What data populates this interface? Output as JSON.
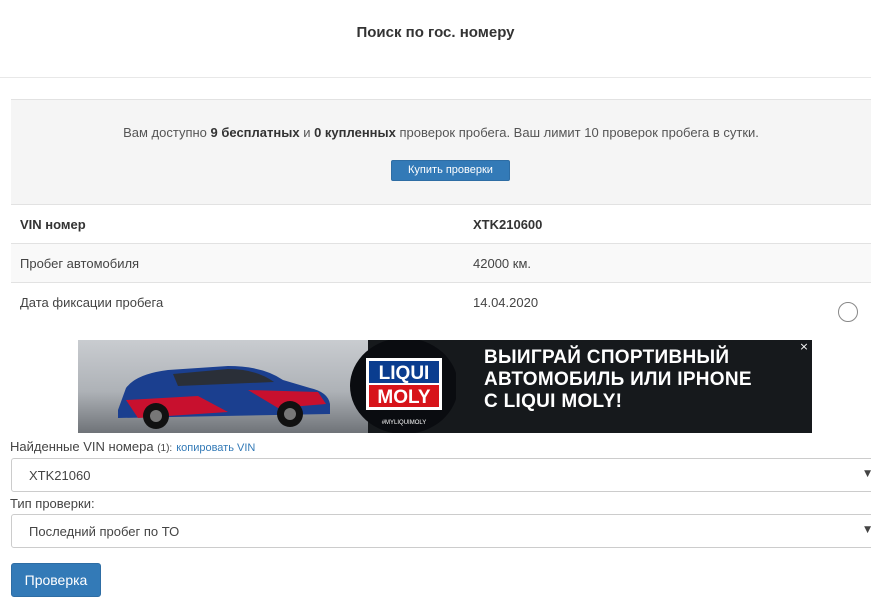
{
  "header": {
    "title": "Поиск по гос. номеру"
  },
  "notice": {
    "text_before": "Вам доступно ",
    "free_count": "9 бесплатных",
    "text_and": " и ",
    "bought_count": "0 купленных",
    "text_after": " проверок пробега. Ваш лимит 10 проверок пробега в сутки.",
    "buy_button": "Купить проверки"
  },
  "info_rows": [
    {
      "label": "VIN номер",
      "value": "XTK210600"
    },
    {
      "label": "Пробег автомобиля",
      "value": "42000 км."
    },
    {
      "label": "Дата фиксации пробега",
      "value": "14.04.2020"
    }
  ],
  "ad": {
    "headline_line1": "ВЫИГРАЙ СПОРТИВНЫЙ",
    "headline_line2": "АВТОМОБИЛЬ ИЛИ IPHONE",
    "headline_line3": "С LIQUI MOLY!",
    "logo_top": "LIQUI",
    "logo_bottom": "MOLY",
    "hashtag": "#MYLIQUIMOLY",
    "close": "×",
    "colors": {
      "logo_red": "#d7141a",
      "logo_blue": "#0a3d8f",
      "car_blue": "#1b3f8f",
      "car_red": "#c8102e"
    }
  },
  "vin_found": {
    "label": "Найденные VIN номера",
    "count": "(1):",
    "copy_link": "копировать VIN",
    "selected": "XTK21060"
  },
  "check_type": {
    "label": "Тип проверки:",
    "selected": "Последний пробег по ТО"
  },
  "submit": {
    "label": "Проверка"
  },
  "colors": {
    "primary": "#337ab7",
    "notice_bg": "#f5f5f5"
  }
}
